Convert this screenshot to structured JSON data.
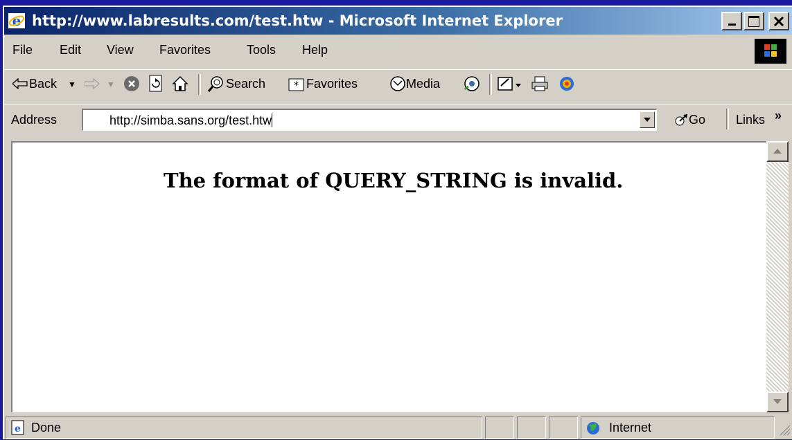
{
  "window": {
    "title": "http://www.labresults.com/test.htw - Microsoft Internet Explorer",
    "controls": {
      "minimize": "_",
      "maximize": "□",
      "close": "×"
    }
  },
  "menu": [
    {
      "label": "File"
    },
    {
      "label": "Edit"
    },
    {
      "label": "View"
    },
    {
      "label": "Favorites"
    },
    {
      "label": "Tools"
    },
    {
      "label": "Help"
    }
  ],
  "toolbar": {
    "back": "Back",
    "search": "Search",
    "favorites": "Favorites",
    "media": "Media"
  },
  "address": {
    "label": "Address",
    "value": "http://simba.sans.org/test.htw",
    "go": "Go",
    "links": "Links",
    "links_chevron": "»"
  },
  "page": {
    "message": "The format of QUERY_STRING is invalid."
  },
  "status": {
    "text": "Done",
    "zone": "Internet"
  },
  "icons": [
    "ie-logo-icon",
    "windows-throbber-icon",
    "back-arrow-icon",
    "forward-arrow-icon",
    "stop-icon",
    "refresh-icon",
    "home-icon",
    "search-icon",
    "favorites-icon",
    "media-icon",
    "history-icon",
    "mail-icon",
    "print-icon",
    "messenger-icon",
    "go-arrow-icon",
    "page-icon",
    "globe-icon"
  ],
  "colors": {
    "title_start": "#0a246a",
    "title_end": "#a6caf0",
    "chrome": "#d4d0c8",
    "desktop": "#1a1aa0"
  }
}
